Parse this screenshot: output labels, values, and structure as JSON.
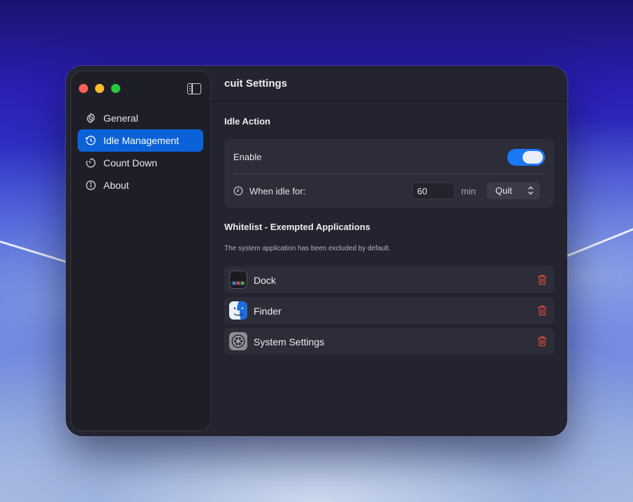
{
  "window": {
    "title": "cuit Settings"
  },
  "sidebar": {
    "items": [
      {
        "label": "General",
        "icon": "gear-icon",
        "active": false
      },
      {
        "label": "Idle Management",
        "icon": "history-clock-icon",
        "active": true
      },
      {
        "label": "Count Down",
        "icon": "timer-icon",
        "active": false
      },
      {
        "label": "About",
        "icon": "info-icon",
        "active": false
      }
    ]
  },
  "idle_action": {
    "section_title": "Idle Action",
    "enable_label": "Enable",
    "enable_on": true,
    "idle_label": "When idle for:",
    "idle_minutes": "60",
    "unit": "min",
    "action": "Quit"
  },
  "whitelist": {
    "section_title": "Whitelist - Exempted Applications",
    "hint": "The system application has been excluded by default.",
    "apps": [
      {
        "name": "Dock",
        "icon": "dock-app-icon"
      },
      {
        "name": "Finder",
        "icon": "finder-app-icon"
      },
      {
        "name": "System Settings",
        "icon": "system-settings-app-icon"
      }
    ]
  },
  "colors": {
    "accent": "#0b62d8",
    "toggle_on": "#1a78f2",
    "delete": "#d9483b",
    "window_bg": "#242430",
    "sidebar_bg": "#1e1e27"
  }
}
